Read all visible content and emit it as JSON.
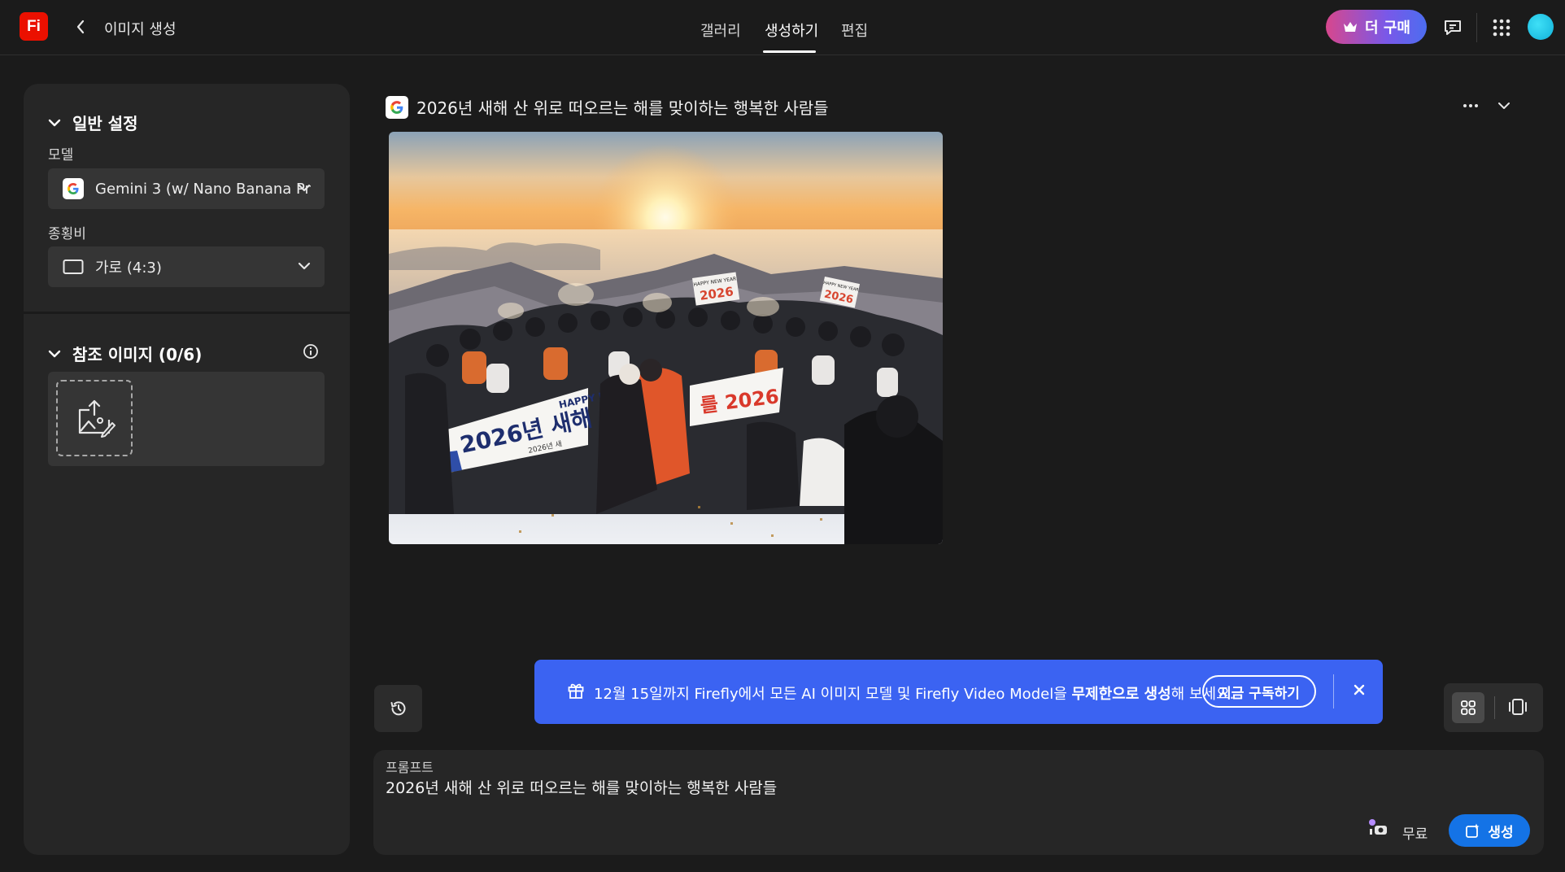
{
  "app": {
    "logo_text": "Fi",
    "page_title": "이미지 생성"
  },
  "nav": {
    "tabs": [
      {
        "label": "갤러리"
      },
      {
        "label": "생성하기"
      },
      {
        "label": "편집"
      }
    ],
    "active_tab": "생성하기"
  },
  "header": {
    "buy_label": "더 구매"
  },
  "settings": {
    "general_title": "일반 설정",
    "model_label": "모델",
    "model_value": "Gemini 3 (w/ Nano Banana Pr",
    "aspect_label": "종횡비",
    "aspect_value": "가로 (4:3)",
    "reference_title": "참조 이미지 (0/6)"
  },
  "result": {
    "prompt_title": "2026년 새해 산 위로 떠오르는 해를 맞이하는 행복한 사람들"
  },
  "image_text": {
    "banner_line1": "HAPPY NEW",
    "banner_main": "2026년 새해 읔",
    "banner_right": "를 2026",
    "banner_small": "2026년 새",
    "sign_left_small": "HAPPY NEW YEAR",
    "sign_left_year": "2026",
    "sign_right_small": "HAPPY NEW YEAR",
    "sign_right_year": "2026"
  },
  "promo": {
    "text_part1": "12월 15일까지 Firefly에서 모든 AI 이미지 모델 및 Firefly Video Model을 ",
    "text_bold1": "무제한으로 생성",
    "text_part2": "해 보세요.",
    "button_label": "지금 구독하기"
  },
  "prompt": {
    "label": "프롬프트",
    "value": "2026년 새해 산 위로 떠오르는 해를 맞이하는 행복한 사람들",
    "cost_label": "무료",
    "generate_label": "생성"
  },
  "colors": {
    "accent": "#1473e6",
    "promo": "#3b63f2",
    "logo": "#eb1000"
  }
}
